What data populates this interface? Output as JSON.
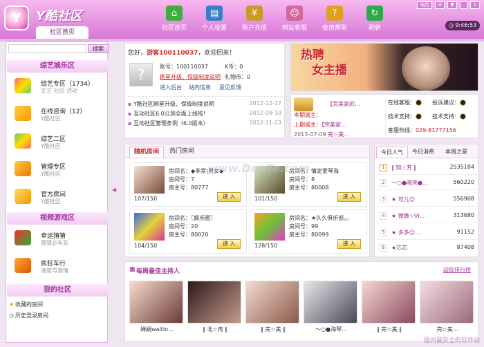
{
  "app": {
    "title": "Y酷社区",
    "home_tab": "社区首页",
    "clock": "9:46:53"
  },
  "nav": [
    {
      "label": "社区首页",
      "icon": "house-icon"
    },
    {
      "label": "个人设置",
      "icon": "profile-card-icon"
    },
    {
      "label": "账户充值",
      "icon": "coins-icon"
    },
    {
      "label": "网站客服",
      "icon": "service-person-icon"
    },
    {
      "label": "使用帮助",
      "icon": "help-book-icon"
    },
    {
      "label": "刷新",
      "icon": "refresh-icon"
    }
  ],
  "system": {
    "network": "电信"
  },
  "sidebar": {
    "search_placeholder": "",
    "search_button": "搜索",
    "sections": [
      "综艺娱乐区",
      "视频游戏区",
      "我的社区"
    ],
    "items": [
      {
        "title": "综艺专区（1734）",
        "sub": "文艺 社区 活动"
      },
      {
        "title": "在线咨询（12）",
        "sub": "Y酷社区"
      },
      {
        "title": "综艺二区",
        "sub": "Y酷社区"
      },
      {
        "title": "管理专区",
        "sub": "Y酷社区"
      },
      {
        "title": "官方房间",
        "sub": "Y酷社区"
      },
      {
        "title": "幸运猜猜",
        "sub": "猜猜必有奖"
      },
      {
        "title": "疯狂车行",
        "sub": "速度与激情"
      }
    ],
    "my": [
      {
        "label": "收藏的房间"
      },
      {
        "label": "历史登录房间"
      }
    ]
  },
  "welcome": {
    "greeting_pre": "您好，",
    "guest": "游客100110037",
    "greeting_post": "，欢迎回来！",
    "account_label": "账号：",
    "account": "100110037",
    "kcoin_label": "K币：",
    "kcoin": "0",
    "gift_label": "礼物币：",
    "gift": "0",
    "rename_link": "刷星升级、保级制度说明",
    "links": [
      "进入后台",
      "站内信息",
      "意见反馈"
    ],
    "news": [
      {
        "text": "Y酷社区刷星升级、保级制度说明",
        "date": "2012-12-17"
      },
      {
        "text": "互动社区6.0公测全面上线啦！",
        "date": "2012-09-10"
      },
      {
        "text": "互动社区管理条例（6.0版本）",
        "date": "2012-11-23"
      }
    ]
  },
  "banner": {
    "line1": "热聘",
    "line2": "女主播"
  },
  "owners": {
    "this_week_label": "本期城主：",
    "this_week": "【完美家的...",
    "last_week_label": "上期城主：",
    "last_week": "【完美家...",
    "date": "2013-07-09",
    "date_name": "完☆美...",
    "online_label": "在线客服：",
    "suggest_label": "投诉建议：",
    "tech_label": "技术支持：",
    "tech2_label": "技术支持：",
    "phone_label": "客服热线：",
    "phone": "029-81777156"
  },
  "rooms": {
    "tabs": [
      "随机房间",
      "热门房间"
    ],
    "name_label": "房间名：",
    "no_label": "房间号：",
    "owner_label": "房主号：",
    "enter": "进 入",
    "list": [
      {
        "name": "◆非常|男女◆",
        "no": "7",
        "owner": "80777",
        "count": "107/150"
      },
      {
        "name": "情定爱琴海",
        "no": "8",
        "owner": "80008",
        "count": "101/150"
      },
      {
        "name": "〖娱乐圈〗",
        "no": "20",
        "owner": "80020",
        "count": "104/150"
      },
      {
        "name": "★久久俱乐部。。",
        "no": "99",
        "owner": "80099",
        "count": "128/150"
      }
    ]
  },
  "ranking": {
    "tabs": [
      "今日人气",
      "今日消费",
      "本周之星"
    ],
    "rows": [
      {
        "rank": "1",
        "name": "‖ 知☆芳 ‖",
        "score": "2535184"
      },
      {
        "rank": "2",
        "name": "〜○●晓亮●...",
        "score": "560220"
      },
      {
        "rank": "3",
        "name": "★ 可儿☺",
        "score": "556908"
      },
      {
        "rank": "4",
        "name": "★ 微微☆VI...",
        "score": "313680"
      },
      {
        "rank": "5",
        "name": "★ 多多☺...",
        "score": "91152"
      },
      {
        "rank": "6",
        "name": "★芯芯",
        "score": "87408"
      }
    ]
  },
  "hosts": {
    "title": "每周最佳主持人",
    "more": "超级排行榜",
    "list": [
      {
        "name": "婵娟waitin..."
      },
      {
        "name": "‖ 北☆冉 ‖"
      },
      {
        "name": "‖ 完☆美 ‖"
      },
      {
        "name": "〜○●海琴..."
      },
      {
        "name": "‖ 完☆美 ‖"
      },
      {
        "name": "完☆美..."
      }
    ]
  },
  "watermark": "国内最安全的软件站",
  "centermark": "www.DuoTe.com"
}
